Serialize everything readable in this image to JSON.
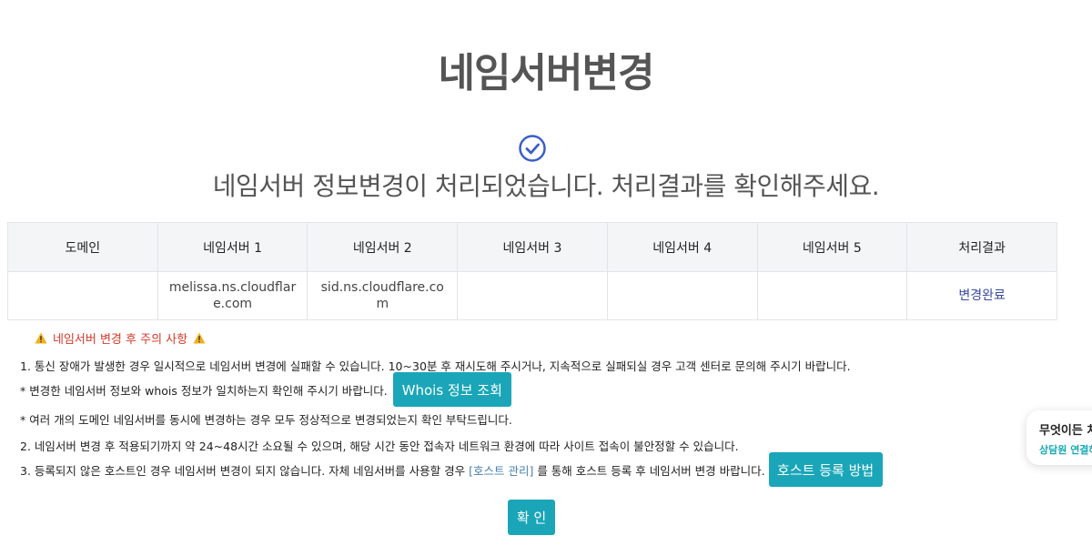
{
  "page": {
    "title": "네임서버변경",
    "result_message": "네임서버 정보변경이 처리되었습니다. 처리결과를 확인해주세요."
  },
  "table": {
    "headers": [
      "도메인",
      "네임서버 1",
      "네임서버 2",
      "네임서버 3",
      "네임서버 4",
      "네임서버 5",
      "처리결과"
    ],
    "rows": [
      [
        "",
        "melissa.ns.cloudflare.com",
        "sid.ns.cloudflare.com",
        "",
        "",
        "",
        "변경완료"
      ]
    ]
  },
  "notice": {
    "title": "네임서버 변경 후 주의 사항",
    "line1": "1. 통신 장애가 발생한 경우 일시적으로 네임서버 변경에 실패할 수 있습니다. 10~30분 후 재시도해 주시거나, 지속적으로 실패되실 경우 고객 센터로 문의해 주시기 바랍니다.",
    "line2": "* 변경한 네임서버 정보와 whois 정보가 일치하는지 확인해 주시기 바랍니다.",
    "whois_button": "Whois 정보 조회",
    "line3": "* 여러 개의 도메인 네임서버를 동시에 변경하는 경우 모두 정상적으로 변경되었는지 확인 부탁드립니다.",
    "line4": "2. 네임서버 변경 후 적용되기까지 약 24~48시간 소요될 수 있으며, 해당 시간 동안 접속자 네트워크 환경에 따라 사이트 접속이 불안정할 수 있습니다.",
    "line5_pre": "3. 등록되지 않은 호스트인 경우 네임서버 변경이 되지 않습니다. 자체 네임서버를 사용할 경우",
    "line5_link": "[호스트 관리]",
    "line5_post": "를 통해 호스트 등록 후 네임서버 변경 바랍니다.",
    "host_button": "호스트 등록 방법"
  },
  "confirm_button": "확 인",
  "chat": {
    "title": "무엇이든 처",
    "subtitle": "상담원 연결하"
  },
  "colors": {
    "accent": "#1aa6b8",
    "warning": "#d23b2a",
    "status": "#3a4aa0",
    "check": "#3a5fc8"
  },
  "icons": {
    "check": "check-circle-icon",
    "warning": "warning-triangle-icon"
  }
}
